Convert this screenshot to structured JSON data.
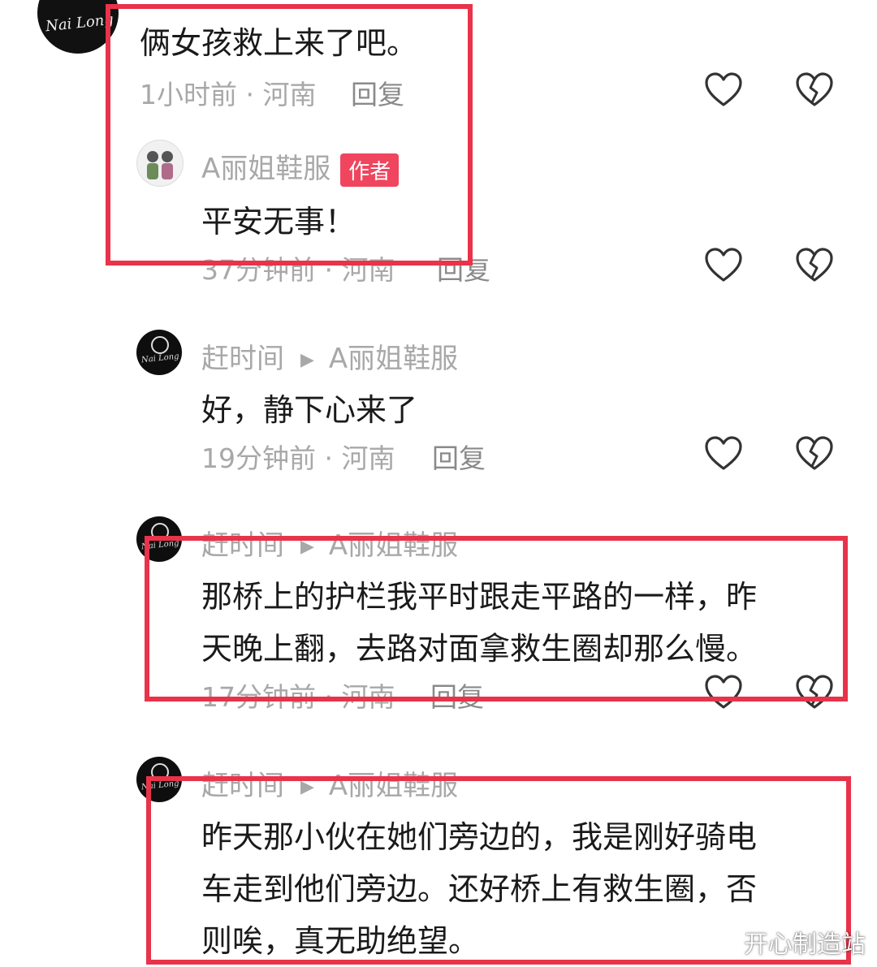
{
  "comment_main": {
    "avatar_signature": "Nai Long",
    "text": "俩女孩救上来了吧。",
    "time": "1小时前 · 河南",
    "reply": "回复"
  },
  "reply_author": {
    "name": "A丽姐鞋服",
    "badge": "作者",
    "text": "平安无事！",
    "time": "37分钟前 · 河南",
    "reply": "回复"
  },
  "reply_1": {
    "avatar_signature": "Nai Long",
    "name": "赶时间",
    "reply_to": "A丽姐鞋服",
    "text": "好，静下心来了",
    "time": "19分钟前 · 河南",
    "reply": "回复"
  },
  "reply_2": {
    "avatar_signature": "Nai Long",
    "name": "赶时间",
    "reply_to": "A丽姐鞋服",
    "text_line1": "那桥上的护栏我平时跟走平路的一样，昨",
    "text_line2": "天晚上翻，去路对面拿救生圈却那么慢。",
    "time": "17分钟前 · 河南",
    "reply": "回复"
  },
  "reply_3": {
    "avatar_signature": "Nai Long",
    "name": "赶时间",
    "reply_to": "A丽姐鞋服",
    "text_line1": "昨天那小伙在她们旁边的，我是刚好骑电",
    "text_line2": "车走到他们旁边。还好桥上有救生圈，否",
    "text_line3": "则唉，真无助绝望。"
  },
  "icons": {
    "like": "heart-outline-icon",
    "dislike": "broken-heart-icon",
    "reply_arrow": "play-triangle-icon"
  },
  "colors": {
    "highlight_box": "#e8334a",
    "author_badge": "#f0455e",
    "meta_text": "#a8a8a8"
  },
  "watermark": "开心制造站"
}
